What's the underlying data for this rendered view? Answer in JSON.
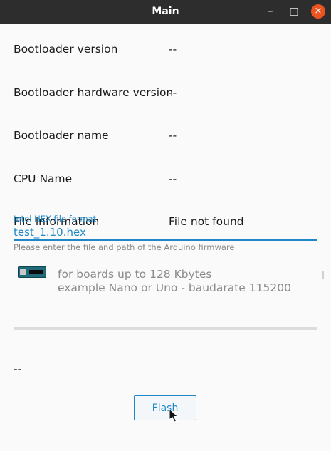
{
  "window": {
    "title": "Main",
    "minimize_glyph": "–",
    "maximize_glyph": "□",
    "close_glyph": "×"
  },
  "info_rows": [
    {
      "label": "Bootloader version",
      "value": "--"
    },
    {
      "label": "Bootloader hardware version",
      "value": "--"
    },
    {
      "label": "Bootloader name",
      "value": "--"
    },
    {
      "label": "CPU Name",
      "value": "--"
    },
    {
      "label": "File information",
      "value": "File not found"
    }
  ],
  "hex_field": {
    "caption": "Intel HEX file format",
    "value": "test_1.10.hex",
    "helper": "Please enter the file and path of the Arduino firmware"
  },
  "board_option": {
    "icon": "arduino-board-icon",
    "line1": "for boards up to 128 Kbytes",
    "line2": "example Nano or Uno - baudarate 115200"
  },
  "progress": {
    "fraction": 0
  },
  "status_text": "--",
  "flash_button": {
    "label": "Flash"
  },
  "colors": {
    "accent": "#1e88c7",
    "titlebar": "#2d2d2d",
    "close": "#e95420"
  }
}
